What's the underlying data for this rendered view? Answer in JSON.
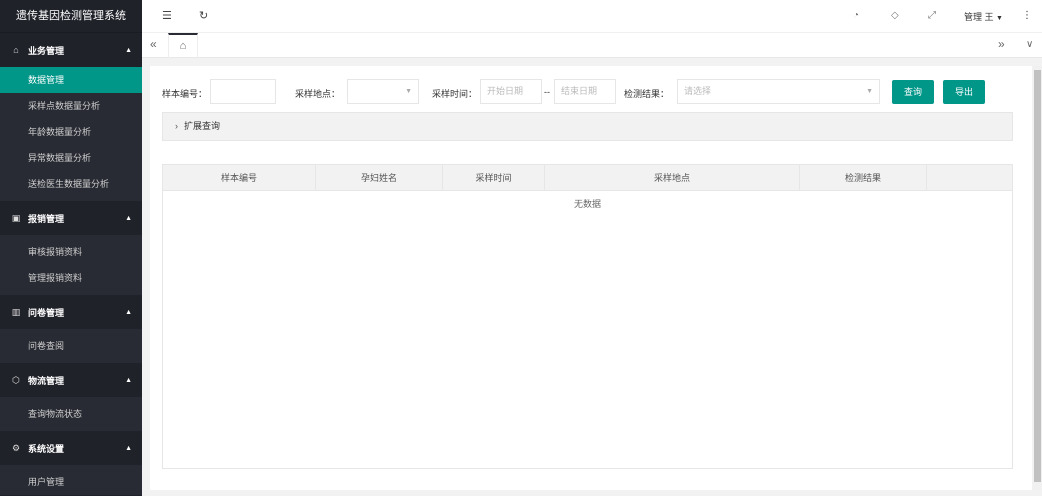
{
  "app": {
    "title": "遗传基因检测管理系统"
  },
  "sidebar": {
    "groups": [
      {
        "label": "业务管理",
        "icon": "home-icon",
        "items": [
          "数据管理",
          "采样点数据量分析",
          "年龄数据量分析",
          "异常数据量分析",
          "送检医生数据量分析"
        ],
        "active": "数据管理"
      },
      {
        "label": "报销管理",
        "icon": "apps-icon",
        "items": [
          "审核报销资料",
          "管理报销资料"
        ]
      },
      {
        "label": "问卷管理",
        "icon": "columns-icon",
        "items": [
          "问卷查阅"
        ]
      },
      {
        "label": "物流管理",
        "icon": "box-icon",
        "items": [
          "查询物流状态"
        ]
      },
      {
        "label": "系统设置",
        "icon": "gear-icon",
        "items": [
          "用户管理"
        ]
      }
    ]
  },
  "topbar": {
    "user": "管理 王"
  },
  "filters": {
    "sample_no_label": "样本编号：",
    "location_label": "采样地点：",
    "time_label": "采样时间：",
    "start_placeholder": "开始日期",
    "separator": "--",
    "end_placeholder": "结束日期",
    "result_label": "检测结果：",
    "result_placeholder": "请选择",
    "query_button": "查询",
    "export_button": "导出"
  },
  "expand": {
    "label": "扩展查询"
  },
  "table": {
    "columns": [
      "样本编号",
      "孕妇姓名",
      "采样时间",
      "采样地点",
      "检测结果"
    ],
    "empty_text": "无数据"
  },
  "colors": {
    "accent": "#009688",
    "sidebar_bg": "#20222a"
  }
}
